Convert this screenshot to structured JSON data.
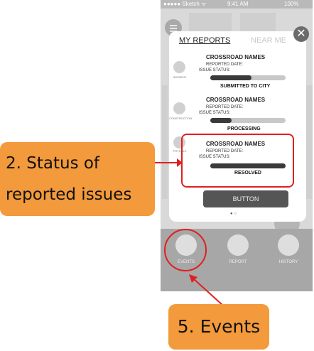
{
  "status_bar": {
    "carrier": "●●●●● Sketch ᯤ",
    "time": "9:41 AM",
    "battery": "100%"
  },
  "tabs": {
    "active": "MY REPORTS",
    "inactive": "NEAR ME"
  },
  "reports": [
    {
      "category": "INCIDENT",
      "title": "CROSSROAD NAMES",
      "date_label": "REPORTED DATE:",
      "status_label": "ISSUE STATUS:",
      "progress": 0.55,
      "result": "SUBMITTED TO  CITY"
    },
    {
      "category": "CONSTRUCTION",
      "title": "CROSSROAD NAMES",
      "date_label": "REPORTED DATE:",
      "status_label": "ISSUE STATUS:",
      "progress": 0.28,
      "result": "PROCESSING"
    },
    {
      "category": "POTHOLE",
      "title": "CROSSROAD NAMES",
      "date_label": "REPORTED DATE:",
      "status_label": "ISSUE STATUS:",
      "progress": 1.0,
      "result": "RESOLVED"
    }
  ],
  "button_label": "BUTTON",
  "pager": "● ○",
  "nav": [
    "EVENTS",
    "REPORT",
    "HISTORY"
  ],
  "close_glyph": "✕",
  "callouts": {
    "status": "2. Status of\nreported issues",
    "events": "5. Events"
  },
  "colors": {
    "highlight": "#e02020",
    "callout": "#f39a3c"
  }
}
